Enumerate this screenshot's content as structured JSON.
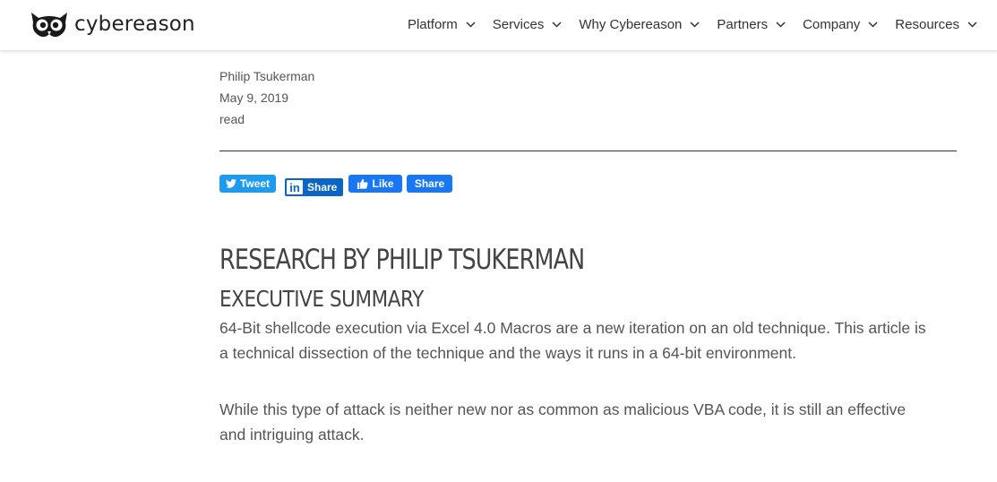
{
  "brand": {
    "name": "cybereason",
    "logo_icon": "owl-icon"
  },
  "nav": {
    "items": [
      {
        "label": "Platform",
        "icon": "chevron-down-icon"
      },
      {
        "label": "Services",
        "icon": "chevron-down-icon"
      },
      {
        "label": "Why Cybereason",
        "icon": "chevron-down-icon"
      },
      {
        "label": "Partners",
        "icon": "chevron-down-icon"
      },
      {
        "label": "Company",
        "icon": "chevron-down-icon"
      },
      {
        "label": "Resources",
        "icon": "chevron-down-icon"
      }
    ]
  },
  "article": {
    "author": "Philip Tsukerman",
    "date": "May 9, 2019",
    "read_time": "read",
    "share": {
      "tweet_label": "Tweet",
      "linkedin_label": "Share",
      "like_label": "Like",
      "facebook_share_label": "Share"
    },
    "title": "RESEARCH BY PHILIP TSUKERMAN",
    "section_heading": "EXECUTIVE SUMMARY",
    "paragraphs": [
      "64-Bit shellcode execution via Excel 4.0 Macros are a new iteration on an old technique. This article is a technical dissection of the technique and the ways it runs in a 64-bit environment.",
      "While this type of attack is neither new nor as common as malicious VBA code, it is still an effective and intriguing attack."
    ]
  },
  "colors": {
    "twitter": "#1d9bf0",
    "linkedin": "#0a66c2",
    "facebook": "#1877f2",
    "text": "#555555",
    "heading": "#444444"
  }
}
